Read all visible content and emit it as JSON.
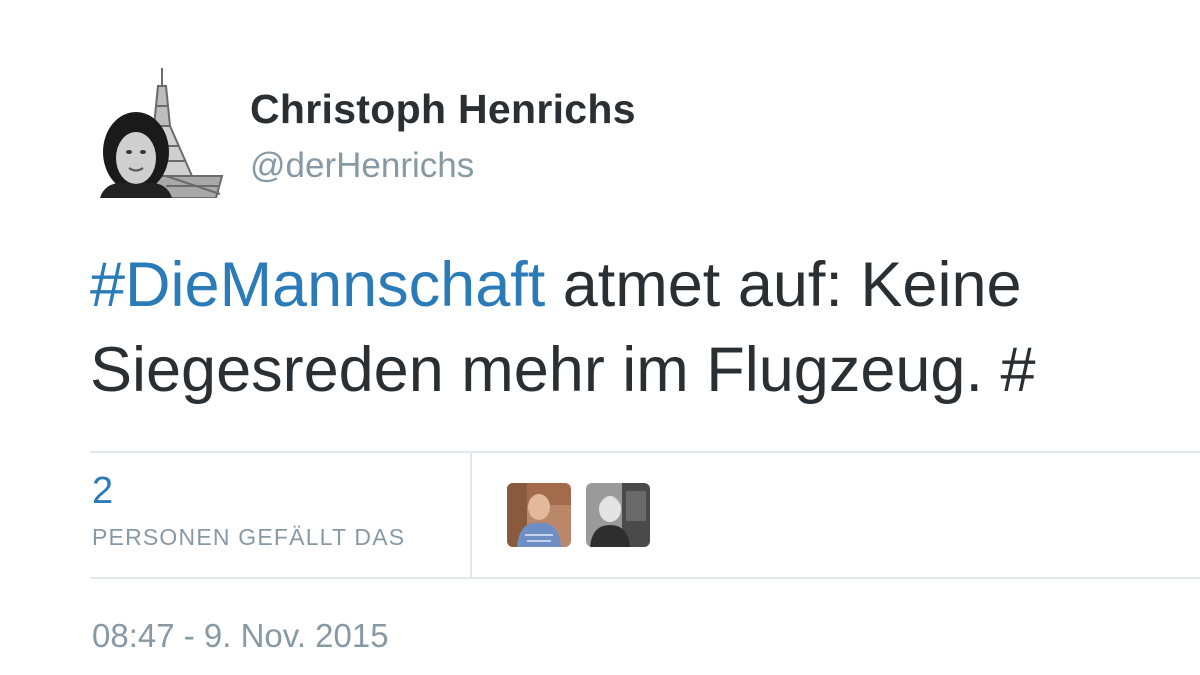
{
  "author": {
    "display_name": "Christoph Henrichs",
    "handle": "@derHenrichs"
  },
  "tweet": {
    "hashtag": "#DieMannschaft",
    "line1_rest": " atmet auf: Keine",
    "line2": "Siegesreden mehr im Flugzeug. #"
  },
  "likes": {
    "count": "2",
    "label": "PERSONEN GEFÄLLT DAS"
  },
  "timestamp": "08:47 - 9. Nov. 2015",
  "colors": {
    "link": "#2b7bb9",
    "text": "#292f33",
    "muted": "#8899a6",
    "divider": "#e1e8ed"
  }
}
